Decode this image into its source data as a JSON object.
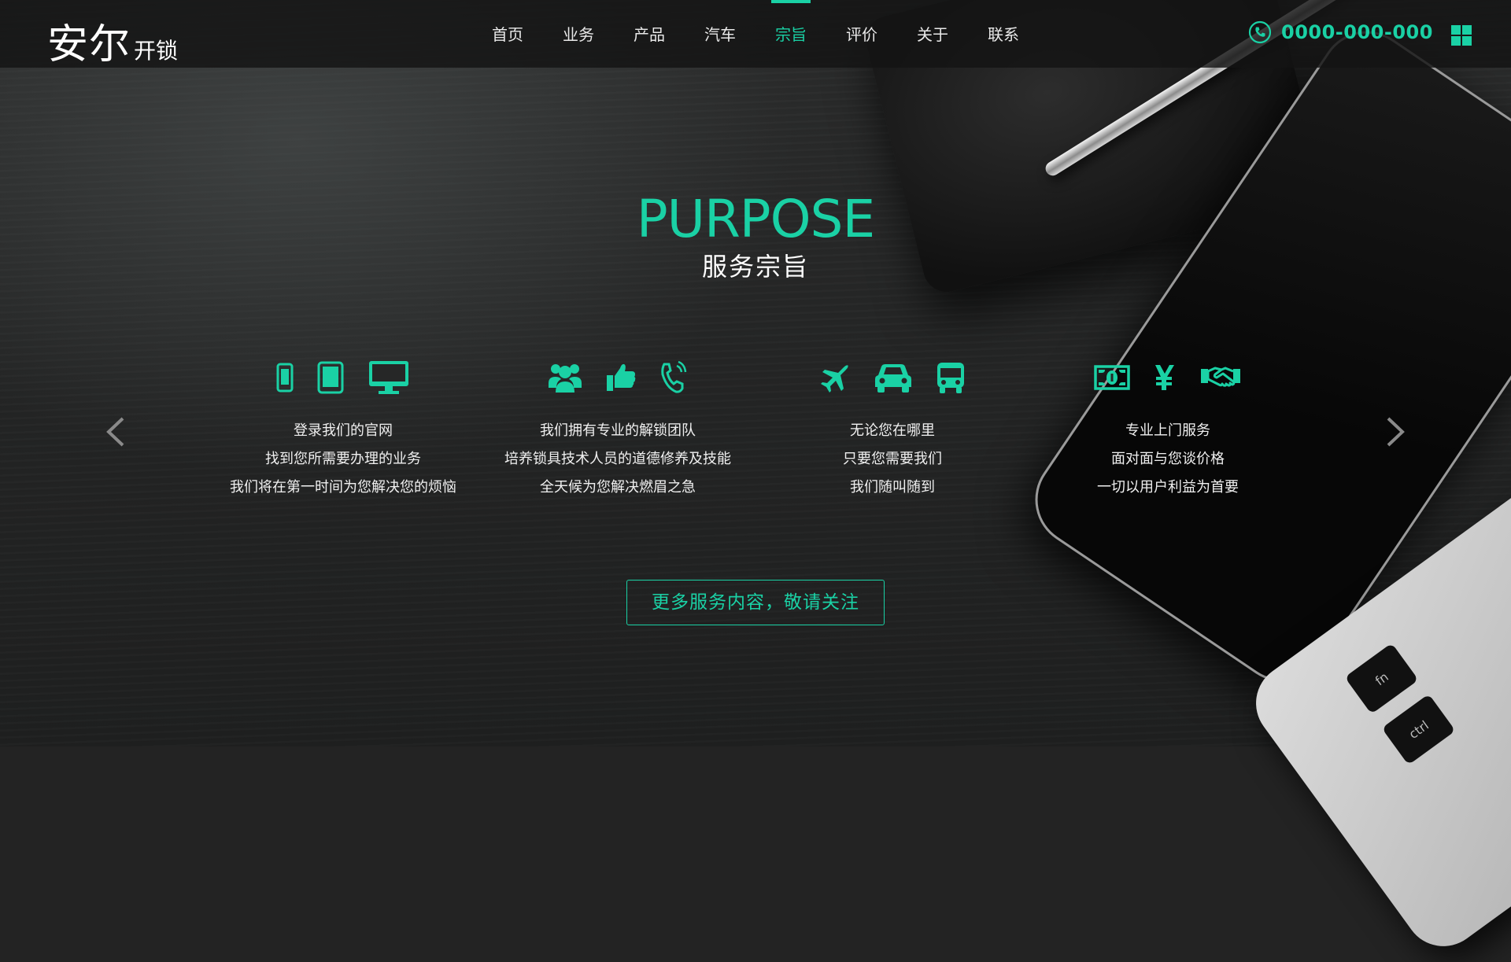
{
  "brand": {
    "name_big": "安尔",
    "name_small": "开锁"
  },
  "nav": {
    "items": [
      {
        "label": "首页"
      },
      {
        "label": "业务"
      },
      {
        "label": "产品"
      },
      {
        "label": "汽车"
      },
      {
        "label": "宗旨"
      },
      {
        "label": "评价"
      },
      {
        "label": "关于"
      },
      {
        "label": "联系"
      }
    ],
    "active": "宗旨"
  },
  "contact": {
    "phone": "0000-000-000",
    "phone_icon": "phone-circle-icon",
    "menu_icon": "grid-menu-icon"
  },
  "section": {
    "title": "PURPOSE",
    "subtitle": "服务宗旨",
    "columns": [
      {
        "icons": [
          "mobile-phone-icon",
          "tablet-icon",
          "desktop-icon"
        ],
        "lines": [
          "登录我们的官网",
          "找到您所需要办理的业务",
          "我们将在第一时间为您解决您的烦恼"
        ]
      },
      {
        "icons": [
          "users-group-icon",
          "thumbs-up-icon",
          "phone-volume-icon"
        ],
        "lines": [
          "我们拥有专业的解锁团队",
          "培养锁具技术人员的道德修养及技能",
          "全天候为您解决燃眉之急"
        ]
      },
      {
        "icons": [
          "plane-icon",
          "car-icon",
          "bus-icon"
        ],
        "lines": [
          "无论您在哪里",
          "只要您需要我们",
          "我们随叫随到"
        ]
      },
      {
        "icons": [
          "money-bill-icon",
          "yen-icon",
          "handshake-icon"
        ],
        "lines": [
          "专业上门服务",
          "面对面与您谈价格",
          "一切以用户利益为首要"
        ]
      }
    ],
    "cta_label": "更多服务内容，敬请关注"
  },
  "carousel": {
    "prev_icon": "chevron-left-icon",
    "next_icon": "chevron-right-icon"
  },
  "decor": {
    "laptop_keys": [
      "fn",
      "ctrl"
    ]
  },
  "colors": {
    "accent": "#1ad1a5",
    "header_bg": "#141414",
    "text": "#f0f0f0"
  }
}
